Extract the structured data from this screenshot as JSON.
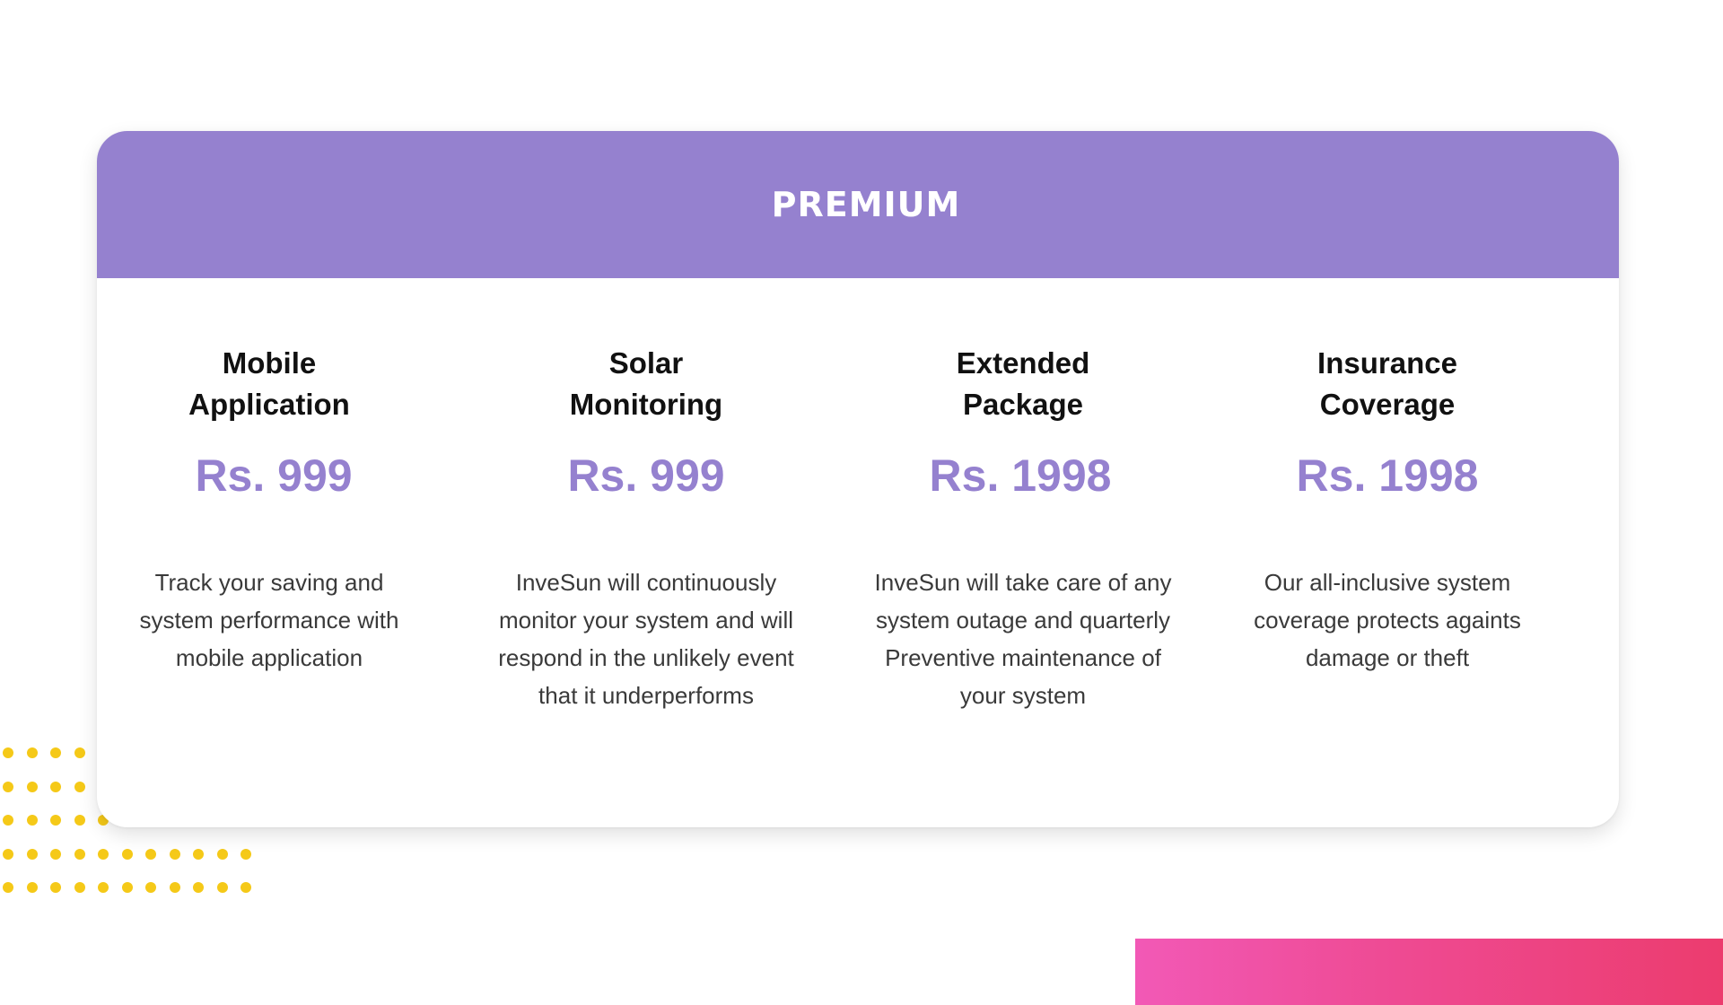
{
  "plan": {
    "title": "PREMIUM"
  },
  "features": [
    {
      "title": "Mobile\nApplication",
      "price": "Rs. 999",
      "description": "Track your saving and system performance with mobile application"
    },
    {
      "title": "Solar\nMonitoring",
      "price": "Rs. 999",
      "description": "InveSun will continuously monitor your system and will respond in the unlikely event that it underperforms"
    },
    {
      "title": "Extended\nPackage",
      "price": "Rs. 1998",
      "description": "InveSun will take care of any system outage and quarterly Preventive maintenance of your system"
    },
    {
      "title": "Insurance\nCoverage",
      "price": "Rs. 1998",
      "description": "Our all-inclusive system coverage protects againts damage or theft"
    }
  ],
  "colors": {
    "accent": "#9581cf",
    "dots": "#f5c918",
    "gradient_start": "#f259b6",
    "gradient_end": "#ec3c6e"
  }
}
